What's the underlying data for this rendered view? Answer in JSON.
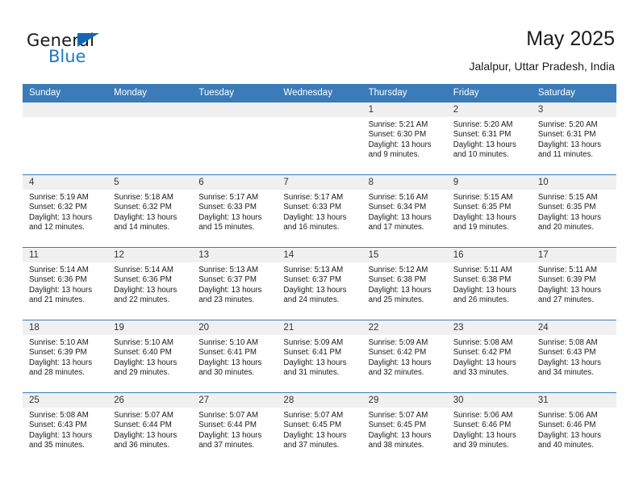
{
  "brand": {
    "word_one": "General",
    "word_two": "Blue",
    "accent_color": "#1f7ac4",
    "triangle_color": "#1268b3"
  },
  "header": {
    "title": "May 2025",
    "subtitle": "Jalalpur, Uttar Pradesh, India"
  },
  "theme": {
    "header_bg": "#3b7cb8",
    "daynum_bg": "#f0f0f0",
    "divider": "#3b7cb8"
  },
  "weekday_headers": [
    "Sunday",
    "Monday",
    "Tuesday",
    "Wednesday",
    "Thursday",
    "Friday",
    "Saturday"
  ],
  "weeks": [
    [
      {
        "day": "",
        "sunrise": "",
        "sunset": "",
        "daylight_1": "",
        "daylight_2": ""
      },
      {
        "day": "",
        "sunrise": "",
        "sunset": "",
        "daylight_1": "",
        "daylight_2": ""
      },
      {
        "day": "",
        "sunrise": "",
        "sunset": "",
        "daylight_1": "",
        "daylight_2": ""
      },
      {
        "day": "",
        "sunrise": "",
        "sunset": "",
        "daylight_1": "",
        "daylight_2": ""
      },
      {
        "day": "1",
        "sunrise": "Sunrise: 5:21 AM",
        "sunset": "Sunset: 6:30 PM",
        "daylight_1": "Daylight: 13 hours",
        "daylight_2": "and 9 minutes."
      },
      {
        "day": "2",
        "sunrise": "Sunrise: 5:20 AM",
        "sunset": "Sunset: 6:31 PM",
        "daylight_1": "Daylight: 13 hours",
        "daylight_2": "and 10 minutes."
      },
      {
        "day": "3",
        "sunrise": "Sunrise: 5:20 AM",
        "sunset": "Sunset: 6:31 PM",
        "daylight_1": "Daylight: 13 hours",
        "daylight_2": "and 11 minutes."
      }
    ],
    [
      {
        "day": "4",
        "sunrise": "Sunrise: 5:19 AM",
        "sunset": "Sunset: 6:32 PM",
        "daylight_1": "Daylight: 13 hours",
        "daylight_2": "and 12 minutes."
      },
      {
        "day": "5",
        "sunrise": "Sunrise: 5:18 AM",
        "sunset": "Sunset: 6:32 PM",
        "daylight_1": "Daylight: 13 hours",
        "daylight_2": "and 14 minutes."
      },
      {
        "day": "6",
        "sunrise": "Sunrise: 5:17 AM",
        "sunset": "Sunset: 6:33 PM",
        "daylight_1": "Daylight: 13 hours",
        "daylight_2": "and 15 minutes."
      },
      {
        "day": "7",
        "sunrise": "Sunrise: 5:17 AM",
        "sunset": "Sunset: 6:33 PM",
        "daylight_1": "Daylight: 13 hours",
        "daylight_2": "and 16 minutes."
      },
      {
        "day": "8",
        "sunrise": "Sunrise: 5:16 AM",
        "sunset": "Sunset: 6:34 PM",
        "daylight_1": "Daylight: 13 hours",
        "daylight_2": "and 17 minutes."
      },
      {
        "day": "9",
        "sunrise": "Sunrise: 5:15 AM",
        "sunset": "Sunset: 6:35 PM",
        "daylight_1": "Daylight: 13 hours",
        "daylight_2": "and 19 minutes."
      },
      {
        "day": "10",
        "sunrise": "Sunrise: 5:15 AM",
        "sunset": "Sunset: 6:35 PM",
        "daylight_1": "Daylight: 13 hours",
        "daylight_2": "and 20 minutes."
      }
    ],
    [
      {
        "day": "11",
        "sunrise": "Sunrise: 5:14 AM",
        "sunset": "Sunset: 6:36 PM",
        "daylight_1": "Daylight: 13 hours",
        "daylight_2": "and 21 minutes."
      },
      {
        "day": "12",
        "sunrise": "Sunrise: 5:14 AM",
        "sunset": "Sunset: 6:36 PM",
        "daylight_1": "Daylight: 13 hours",
        "daylight_2": "and 22 minutes."
      },
      {
        "day": "13",
        "sunrise": "Sunrise: 5:13 AM",
        "sunset": "Sunset: 6:37 PM",
        "daylight_1": "Daylight: 13 hours",
        "daylight_2": "and 23 minutes."
      },
      {
        "day": "14",
        "sunrise": "Sunrise: 5:13 AM",
        "sunset": "Sunset: 6:37 PM",
        "daylight_1": "Daylight: 13 hours",
        "daylight_2": "and 24 minutes."
      },
      {
        "day": "15",
        "sunrise": "Sunrise: 5:12 AM",
        "sunset": "Sunset: 6:38 PM",
        "daylight_1": "Daylight: 13 hours",
        "daylight_2": "and 25 minutes."
      },
      {
        "day": "16",
        "sunrise": "Sunrise: 5:11 AM",
        "sunset": "Sunset: 6:38 PM",
        "daylight_1": "Daylight: 13 hours",
        "daylight_2": "and 26 minutes."
      },
      {
        "day": "17",
        "sunrise": "Sunrise: 5:11 AM",
        "sunset": "Sunset: 6:39 PM",
        "daylight_1": "Daylight: 13 hours",
        "daylight_2": "and 27 minutes."
      }
    ],
    [
      {
        "day": "18",
        "sunrise": "Sunrise: 5:10 AM",
        "sunset": "Sunset: 6:39 PM",
        "daylight_1": "Daylight: 13 hours",
        "daylight_2": "and 28 minutes."
      },
      {
        "day": "19",
        "sunrise": "Sunrise: 5:10 AM",
        "sunset": "Sunset: 6:40 PM",
        "daylight_1": "Daylight: 13 hours",
        "daylight_2": "and 29 minutes."
      },
      {
        "day": "20",
        "sunrise": "Sunrise: 5:10 AM",
        "sunset": "Sunset: 6:41 PM",
        "daylight_1": "Daylight: 13 hours",
        "daylight_2": "and 30 minutes."
      },
      {
        "day": "21",
        "sunrise": "Sunrise: 5:09 AM",
        "sunset": "Sunset: 6:41 PM",
        "daylight_1": "Daylight: 13 hours",
        "daylight_2": "and 31 minutes."
      },
      {
        "day": "22",
        "sunrise": "Sunrise: 5:09 AM",
        "sunset": "Sunset: 6:42 PM",
        "daylight_1": "Daylight: 13 hours",
        "daylight_2": "and 32 minutes."
      },
      {
        "day": "23",
        "sunrise": "Sunrise: 5:08 AM",
        "sunset": "Sunset: 6:42 PM",
        "daylight_1": "Daylight: 13 hours",
        "daylight_2": "and 33 minutes."
      },
      {
        "day": "24",
        "sunrise": "Sunrise: 5:08 AM",
        "sunset": "Sunset: 6:43 PM",
        "daylight_1": "Daylight: 13 hours",
        "daylight_2": "and 34 minutes."
      }
    ],
    [
      {
        "day": "25",
        "sunrise": "Sunrise: 5:08 AM",
        "sunset": "Sunset: 6:43 PM",
        "daylight_1": "Daylight: 13 hours",
        "daylight_2": "and 35 minutes."
      },
      {
        "day": "26",
        "sunrise": "Sunrise: 5:07 AM",
        "sunset": "Sunset: 6:44 PM",
        "daylight_1": "Daylight: 13 hours",
        "daylight_2": "and 36 minutes."
      },
      {
        "day": "27",
        "sunrise": "Sunrise: 5:07 AM",
        "sunset": "Sunset: 6:44 PM",
        "daylight_1": "Daylight: 13 hours",
        "daylight_2": "and 37 minutes."
      },
      {
        "day": "28",
        "sunrise": "Sunrise: 5:07 AM",
        "sunset": "Sunset: 6:45 PM",
        "daylight_1": "Daylight: 13 hours",
        "daylight_2": "and 37 minutes."
      },
      {
        "day": "29",
        "sunrise": "Sunrise: 5:07 AM",
        "sunset": "Sunset: 6:45 PM",
        "daylight_1": "Daylight: 13 hours",
        "daylight_2": "and 38 minutes."
      },
      {
        "day": "30",
        "sunrise": "Sunrise: 5:06 AM",
        "sunset": "Sunset: 6:46 PM",
        "daylight_1": "Daylight: 13 hours",
        "daylight_2": "and 39 minutes."
      },
      {
        "day": "31",
        "sunrise": "Sunrise: 5:06 AM",
        "sunset": "Sunset: 6:46 PM",
        "daylight_1": "Daylight: 13 hours",
        "daylight_2": "and 40 minutes."
      }
    ]
  ]
}
